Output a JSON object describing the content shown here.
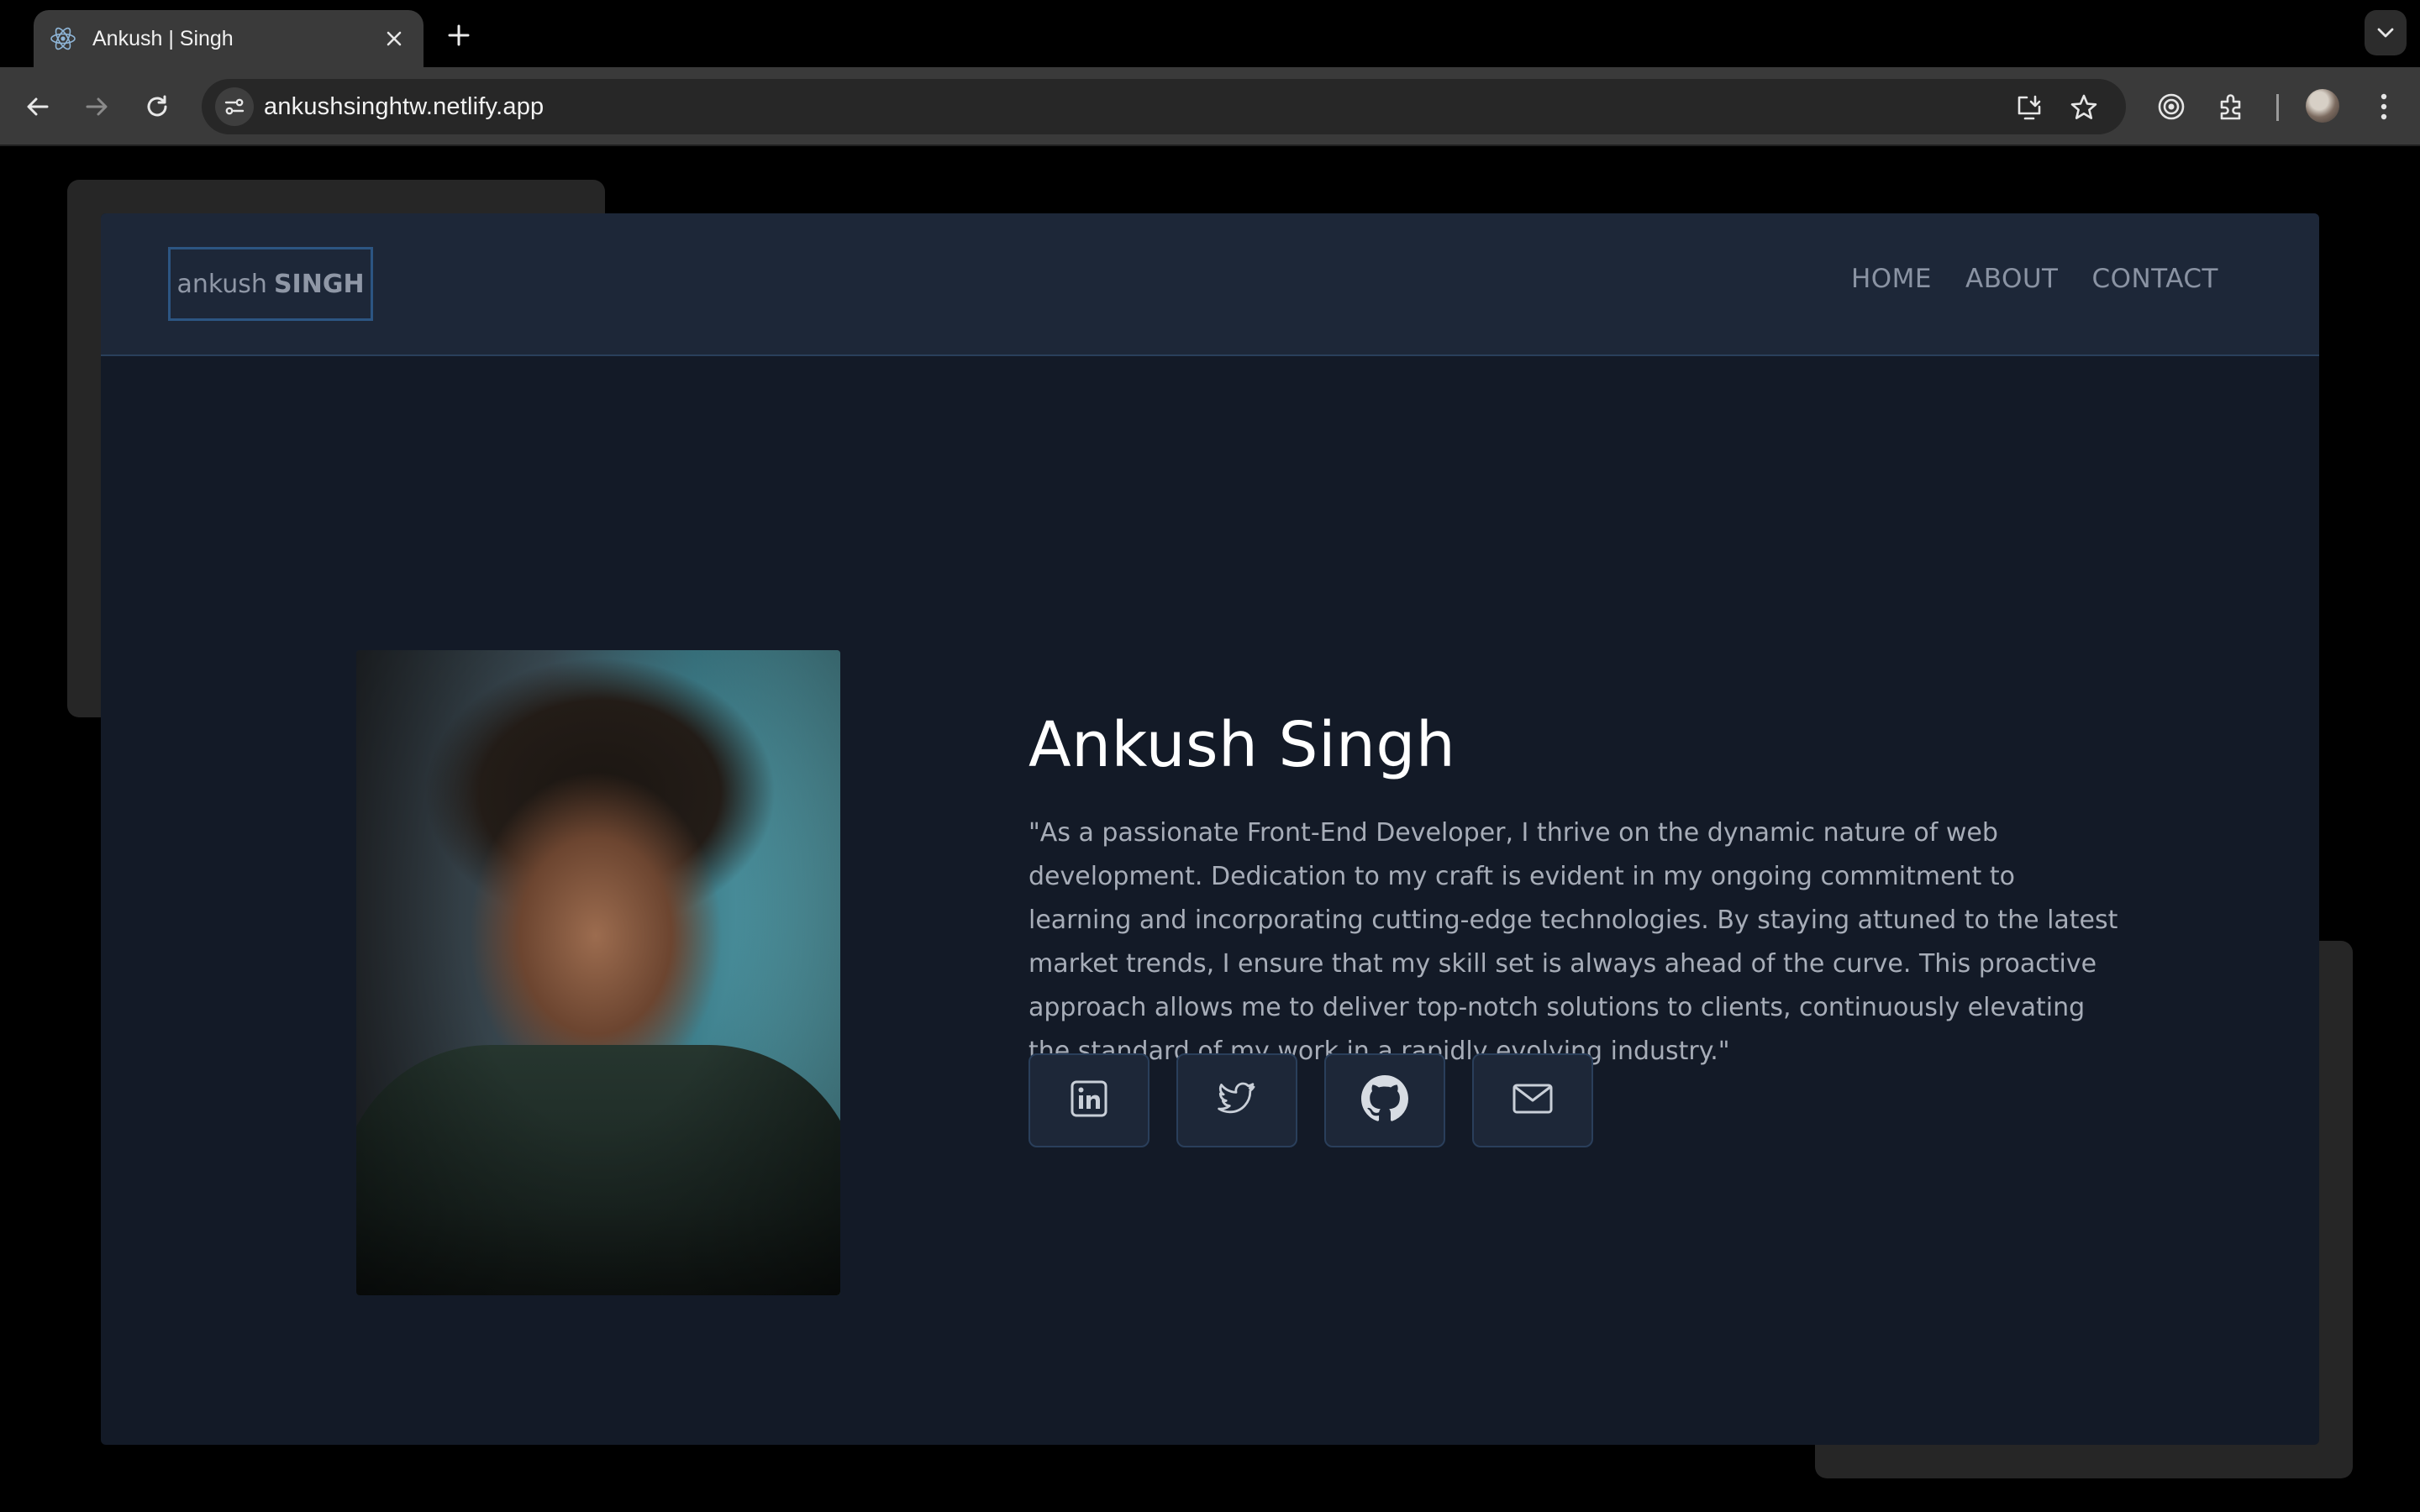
{
  "browser": {
    "tab": {
      "title": "Ankush | Singh",
      "favicon": "react-icon"
    },
    "url": "ankushsinghtw.netlify.app",
    "icons": [
      "back-icon",
      "forward-icon",
      "reload-icon",
      "site-info-icon",
      "install-app-icon",
      "bookmark-star-icon",
      "extension-target-icon",
      "extensions-puzzle-icon",
      "profile-avatar",
      "kebab-menu-icon",
      "tab-list-chevron-icon"
    ]
  },
  "site": {
    "logo": {
      "light": "ankush",
      "bold": "SINGH"
    },
    "nav": [
      {
        "label": "HOME"
      },
      {
        "label": "ABOUT"
      },
      {
        "label": "CONTACT"
      }
    ],
    "hero": {
      "name": "Ankush Singh",
      "bio": "\"As a passionate Front-End Developer, I thrive on the dynamic nature of web development. Dedication to my craft is evident in my ongoing commitment to learning and incorporating cutting-edge technologies. By staying attuned to the latest market trends, I ensure that my skill set is always ahead of the curve. This proactive approach allows me to deliver top-notch solutions to clients, continuously elevating the standard of my work in a rapidly evolving industry.\"",
      "socials": [
        {
          "icon": "linkedin-icon"
        },
        {
          "icon": "twitter-icon"
        },
        {
          "icon": "github-icon"
        },
        {
          "icon": "email-icon"
        }
      ]
    },
    "colors": {
      "background": "#000000",
      "card": "#131a27",
      "header": "#1d2738",
      "border": "#2a3f5b",
      "logo_border": "#2c5582"
    }
  }
}
